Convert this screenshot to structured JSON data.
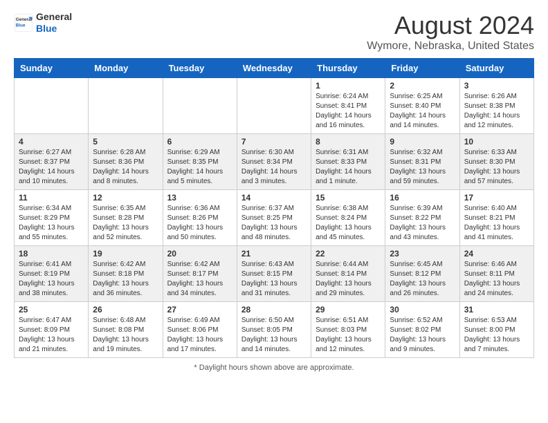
{
  "header": {
    "logo_general": "General",
    "logo_blue": "Blue",
    "main_title": "August 2024",
    "subtitle": "Wymore, Nebraska, United States"
  },
  "calendar": {
    "days_of_week": [
      "Sunday",
      "Monday",
      "Tuesday",
      "Wednesday",
      "Thursday",
      "Friday",
      "Saturday"
    ],
    "weeks": [
      [
        {
          "day": "",
          "info": ""
        },
        {
          "day": "",
          "info": ""
        },
        {
          "day": "",
          "info": ""
        },
        {
          "day": "",
          "info": ""
        },
        {
          "day": "1",
          "info": "Sunrise: 6:24 AM\nSunset: 8:41 PM\nDaylight: 14 hours\nand 16 minutes."
        },
        {
          "day": "2",
          "info": "Sunrise: 6:25 AM\nSunset: 8:40 PM\nDaylight: 14 hours\nand 14 minutes."
        },
        {
          "day": "3",
          "info": "Sunrise: 6:26 AM\nSunset: 8:38 PM\nDaylight: 14 hours\nand 12 minutes."
        }
      ],
      [
        {
          "day": "4",
          "info": "Sunrise: 6:27 AM\nSunset: 8:37 PM\nDaylight: 14 hours\nand 10 minutes."
        },
        {
          "day": "5",
          "info": "Sunrise: 6:28 AM\nSunset: 8:36 PM\nDaylight: 14 hours\nand 8 minutes."
        },
        {
          "day": "6",
          "info": "Sunrise: 6:29 AM\nSunset: 8:35 PM\nDaylight: 14 hours\nand 5 minutes."
        },
        {
          "day": "7",
          "info": "Sunrise: 6:30 AM\nSunset: 8:34 PM\nDaylight: 14 hours\nand 3 minutes."
        },
        {
          "day": "8",
          "info": "Sunrise: 6:31 AM\nSunset: 8:33 PM\nDaylight: 14 hours\nand 1 minute."
        },
        {
          "day": "9",
          "info": "Sunrise: 6:32 AM\nSunset: 8:31 PM\nDaylight: 13 hours\nand 59 minutes."
        },
        {
          "day": "10",
          "info": "Sunrise: 6:33 AM\nSunset: 8:30 PM\nDaylight: 13 hours\nand 57 minutes."
        }
      ],
      [
        {
          "day": "11",
          "info": "Sunrise: 6:34 AM\nSunset: 8:29 PM\nDaylight: 13 hours\nand 55 minutes."
        },
        {
          "day": "12",
          "info": "Sunrise: 6:35 AM\nSunset: 8:28 PM\nDaylight: 13 hours\nand 52 minutes."
        },
        {
          "day": "13",
          "info": "Sunrise: 6:36 AM\nSunset: 8:26 PM\nDaylight: 13 hours\nand 50 minutes."
        },
        {
          "day": "14",
          "info": "Sunrise: 6:37 AM\nSunset: 8:25 PM\nDaylight: 13 hours\nand 48 minutes."
        },
        {
          "day": "15",
          "info": "Sunrise: 6:38 AM\nSunset: 8:24 PM\nDaylight: 13 hours\nand 45 minutes."
        },
        {
          "day": "16",
          "info": "Sunrise: 6:39 AM\nSunset: 8:22 PM\nDaylight: 13 hours\nand 43 minutes."
        },
        {
          "day": "17",
          "info": "Sunrise: 6:40 AM\nSunset: 8:21 PM\nDaylight: 13 hours\nand 41 minutes."
        }
      ],
      [
        {
          "day": "18",
          "info": "Sunrise: 6:41 AM\nSunset: 8:19 PM\nDaylight: 13 hours\nand 38 minutes."
        },
        {
          "day": "19",
          "info": "Sunrise: 6:42 AM\nSunset: 8:18 PM\nDaylight: 13 hours\nand 36 minutes."
        },
        {
          "day": "20",
          "info": "Sunrise: 6:42 AM\nSunset: 8:17 PM\nDaylight: 13 hours\nand 34 minutes."
        },
        {
          "day": "21",
          "info": "Sunrise: 6:43 AM\nSunset: 8:15 PM\nDaylight: 13 hours\nand 31 minutes."
        },
        {
          "day": "22",
          "info": "Sunrise: 6:44 AM\nSunset: 8:14 PM\nDaylight: 13 hours\nand 29 minutes."
        },
        {
          "day": "23",
          "info": "Sunrise: 6:45 AM\nSunset: 8:12 PM\nDaylight: 13 hours\nand 26 minutes."
        },
        {
          "day": "24",
          "info": "Sunrise: 6:46 AM\nSunset: 8:11 PM\nDaylight: 13 hours\nand 24 minutes."
        }
      ],
      [
        {
          "day": "25",
          "info": "Sunrise: 6:47 AM\nSunset: 8:09 PM\nDaylight: 13 hours\nand 21 minutes."
        },
        {
          "day": "26",
          "info": "Sunrise: 6:48 AM\nSunset: 8:08 PM\nDaylight: 13 hours\nand 19 minutes."
        },
        {
          "day": "27",
          "info": "Sunrise: 6:49 AM\nSunset: 8:06 PM\nDaylight: 13 hours\nand 17 minutes."
        },
        {
          "day": "28",
          "info": "Sunrise: 6:50 AM\nSunset: 8:05 PM\nDaylight: 13 hours\nand 14 minutes."
        },
        {
          "day": "29",
          "info": "Sunrise: 6:51 AM\nSunset: 8:03 PM\nDaylight: 13 hours\nand 12 minutes."
        },
        {
          "day": "30",
          "info": "Sunrise: 6:52 AM\nSunset: 8:02 PM\nDaylight: 13 hours\nand 9 minutes."
        },
        {
          "day": "31",
          "info": "Sunrise: 6:53 AM\nSunset: 8:00 PM\nDaylight: 13 hours\nand 7 minutes."
        }
      ]
    ]
  },
  "footer": {
    "note": "Daylight hours"
  }
}
